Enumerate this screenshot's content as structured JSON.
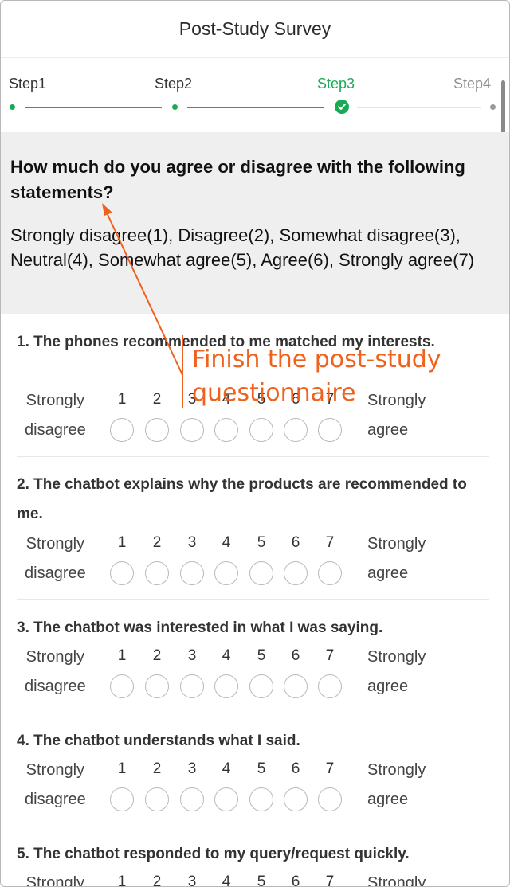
{
  "header": {
    "title": "Post-Study Survey"
  },
  "steps": [
    {
      "label": "Step1",
      "state": "done"
    },
    {
      "label": "Step2",
      "state": "done"
    },
    {
      "label": "Step3",
      "state": "active"
    },
    {
      "label": "Step4",
      "state": "future"
    }
  ],
  "intro": {
    "title": "How much do you agree or disagree with the following statements?",
    "scale_text": "Strongly disagree(1), Disagree(2), Somewhat disagree(3), Neutral(4), Somewhat agree(5), Agree(6), Strongly agree(7)"
  },
  "scale": {
    "left_line1": "Strongly",
    "left_line2": "disagree",
    "right_line1": "Strongly",
    "right_line2": "agree",
    "numbers": [
      "1",
      "2",
      "3",
      "4",
      "5",
      "6",
      "7"
    ]
  },
  "questions": [
    {
      "text": "1. The phones recommended to me matched my interests."
    },
    {
      "text": "2. The chatbot explains why the products are recommended to me."
    },
    {
      "text": "3. The chatbot was interested in what I was saying."
    },
    {
      "text": "4. The chatbot understands what I said."
    },
    {
      "text": "5. The chatbot responded to my query/request quickly."
    }
  ],
  "annotation": {
    "line1": "Finish the post-study",
    "line2": "questionnaire",
    "color": "#f0611c"
  },
  "colors": {
    "accent": "#1aaa55",
    "intro_bg": "#efefef"
  }
}
